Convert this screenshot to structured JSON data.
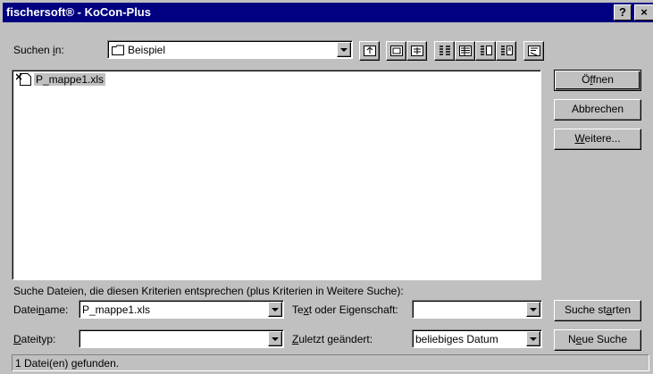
{
  "window": {
    "title": "fischersoft® - KoCon-Plus",
    "help_label": "?",
    "close_label": "×"
  },
  "lookin": {
    "label_pre": "Suchen ",
    "label_u": "i",
    "label_post": "n:",
    "value": "Beispiel"
  },
  "toolbar": {
    "icons": [
      "up-one-level-icon",
      "search-favorites-icon",
      "add-to-favorites-icon",
      "list-view-icon",
      "details-view-icon",
      "properties-view-icon",
      "preview-view-icon",
      "commands-icon"
    ]
  },
  "files": [
    {
      "name": "P_mappe1.xls",
      "icon": "excel-file-icon",
      "selected": true
    }
  ],
  "buttons": {
    "open": {
      "pre": "Ö",
      "u": "f",
      "post": "fnen"
    },
    "cancel": "Abbrechen",
    "more": {
      "pre": "",
      "u": "W",
      "post": "eitere..."
    },
    "start_search": {
      "pre": "Suche st",
      "u": "a",
      "post": "rten"
    },
    "new_search": {
      "pre": "N",
      "u": "e",
      "post": "ue Suche"
    }
  },
  "criteria": {
    "hint": "Suche Dateien, die diesen Kriterien entsprechen (plus Kriterien in Weitere Suche):",
    "filename_label": {
      "pre": "Datei",
      "u": "n",
      "post": "ame:"
    },
    "filename_value": "P_mappe1.xls",
    "text_label": {
      "pre": "Te",
      "u": "x",
      "post": "t oder Eigenschaft:"
    },
    "text_value": "",
    "filetype_label": {
      "pre": "",
      "u": "D",
      "post": "ateityp:"
    },
    "filetype_value": "",
    "modified_label": {
      "pre": "",
      "u": "Z",
      "post": "uletzt geändert:"
    },
    "modified_value": "beliebiges Datum"
  },
  "status": {
    "text": "1 Datei(en) gefunden."
  }
}
